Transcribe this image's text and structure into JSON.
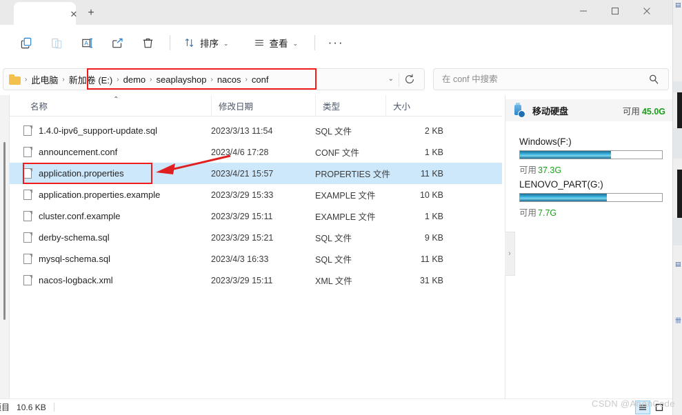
{
  "window": {
    "tab_close_icon": "✕",
    "tab_new_icon": "+",
    "minimize_icon": "minimize",
    "maximize_icon": "maximize",
    "close_icon": "close"
  },
  "toolbar": {
    "copy_label": "copy-icon",
    "paste_label": "paste-icon",
    "rename_label": "rename-icon",
    "share_label": "share-icon",
    "delete_label": "delete-icon",
    "sort_label": "排序",
    "view_label": "查看",
    "more_label": "···",
    "caret": "⌄"
  },
  "address": {
    "breadcrumbs": [
      {
        "label": "此电脑"
      },
      {
        "label": "新加卷 (E:)"
      },
      {
        "label": "demo"
      },
      {
        "label": "seaplayshop"
      },
      {
        "label": "nacos"
      },
      {
        "label": "conf"
      }
    ],
    "separator": "›",
    "dropdown_caret": "⌄"
  },
  "search": {
    "placeholder": "在 conf 中搜索",
    "value": ""
  },
  "columns": [
    {
      "key": "name",
      "label": "名称",
      "sorted": true,
      "sort_caret": "⌃"
    },
    {
      "key": "date",
      "label": "修改日期"
    },
    {
      "key": "type",
      "label": "类型"
    },
    {
      "key": "size",
      "label": "大小"
    }
  ],
  "files": [
    {
      "name": "1.4.0-ipv6_support-update.sql",
      "date": "2023/3/13 11:54",
      "type": "SQL 文件",
      "size": "2 KB",
      "selected": false
    },
    {
      "name": "announcement.conf",
      "date": "2023/4/6 17:28",
      "type": "CONF 文件",
      "size": "1 KB",
      "selected": false
    },
    {
      "name": "application.properties",
      "date": "2023/4/21 15:57",
      "type": "PROPERTIES 文件",
      "size": "11 KB",
      "selected": true
    },
    {
      "name": "application.properties.example",
      "date": "2023/3/29 15:33",
      "type": "EXAMPLE 文件",
      "size": "10 KB",
      "selected": false
    },
    {
      "name": "cluster.conf.example",
      "date": "2023/3/29 15:11",
      "type": "EXAMPLE 文件",
      "size": "1 KB",
      "selected": false
    },
    {
      "name": "derby-schema.sql",
      "date": "2023/3/29 15:21",
      "type": "SQL 文件",
      "size": "9 KB",
      "selected": false
    },
    {
      "name": "mysql-schema.sql",
      "date": "2023/4/3 16:33",
      "type": "SQL 文件",
      "size": "11 KB",
      "selected": false
    },
    {
      "name": "nacos-logback.xml",
      "date": "2023/3/29 15:11",
      "type": "XML 文件",
      "size": "31 KB",
      "selected": false
    }
  ],
  "expand_handle": {
    "icon": "›"
  },
  "drive_panel": {
    "title": "移动硬盘",
    "free_label": "可用",
    "free_value": "45.0G",
    "volumes": [
      {
        "name": "Windows(F:)",
        "free_label": "可用",
        "free_value": "37.3G",
        "used_percent": 64
      },
      {
        "name": "LENOVO_PART(G:)",
        "free_label": "可用",
        "free_value": "7.7G",
        "used_percent": 61
      }
    ]
  },
  "statusbar": {
    "items_text": "项目",
    "size_text": "10.6 KB",
    "view_details_icon": "details-view-icon",
    "view_icons_icon": "large-icons-view-icon"
  },
  "watermark": "CSDN @AnAnCode",
  "colors": {
    "annotation_red": "#f01c1c",
    "selection_blue": "#cde8fb",
    "free_green": "#16a016"
  }
}
